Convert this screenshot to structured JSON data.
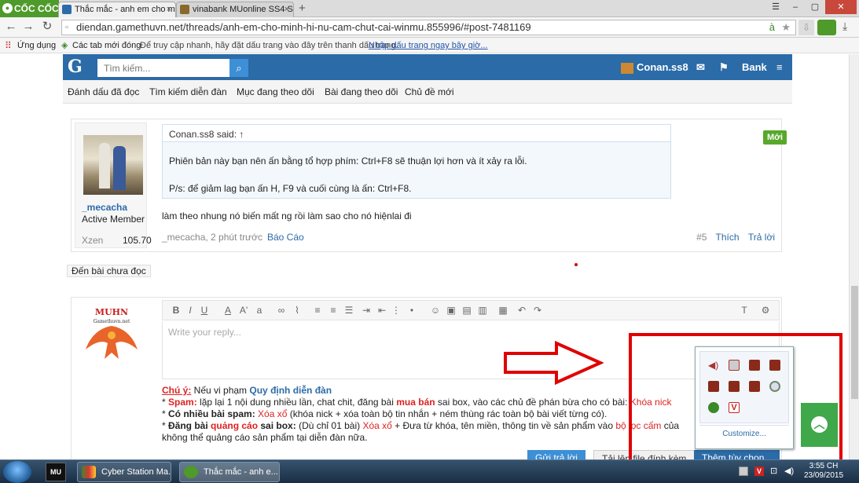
{
  "browser": {
    "logo": "CỐC CỐC",
    "tabs": [
      {
        "title": "Thắc mắc - anh em cho mì",
        "active": true
      },
      {
        "title": "vinabank MUonline SS4 SS",
        "active": false
      }
    ],
    "new_tab": "+",
    "url": "diendan.gamethuvn.net/threads/anh-em-cho-minh-hi-nu-cam-chut-cai-winmu.855996/#post-7481169",
    "bookmarks": {
      "apps": "Ứng dụng",
      "item1": "Các tab mới đóng",
      "hint": "Để truy cập nhanh, hãy đặt dấu trang vào đây trên thanh dấu trang.",
      "link": "Nhập dấu trang ngay bây giờ..."
    }
  },
  "site": {
    "logo": "G",
    "search_placeholder": "Tìm kiếm...",
    "user": "Conan.ss8",
    "bank": "Bank",
    "subnav": [
      "Đánh dấu đã đọc",
      "Tìm kiếm diễn đàn",
      "Mục đang theo dõi",
      "Bài đang theo dõi",
      "Chủ đề mới"
    ]
  },
  "post": {
    "username": "_mecacha",
    "role": "Active Member",
    "xzen_label": "Xzen",
    "xzen_value": "105.70",
    "quote_author": "Conan.ss8 said: ↑",
    "quote_line1": "Phiên bản này bạn nên ấn bằng tổ hợp phím: Ctrl+F8 sẽ thuận lợi hơn và ít xảy ra lỗi.",
    "quote_line2": "P/s: để giảm lag bạn ấn H, F9 và cuối cùng là ấn: Ctrl+F8.",
    "message": "làm theo nhung nó biến mất ng rồi làm sao cho nó hiệnlai đi",
    "meta": "_mecacha, 2 phút trước",
    "report": "Báo Cáo",
    "number": "#5",
    "like": "Thích",
    "reply": "Trả lời",
    "badge": "Mới"
  },
  "unread": "Đến bài chưa đọc",
  "reply": {
    "avatar_text1": "MUHN",
    "avatar_text2": "Gamethuvn.net",
    "placeholder": "Write your reply...",
    "note_title": "Chú ý:",
    "note_title_rest": " Nếu vi phạm ",
    "note_rules": "Quy định diễn đàn",
    "line1_a": "* ",
    "line1_b": "Spam:",
    "line1_c": " lặp lại 1 nội dung nhiều lần, chat chit, đăng bài ",
    "line1_d": "mua bán",
    "line1_e": " sai box, vào các chủ đề phán bừa cho có bài: ",
    "line1_f": "Khóa nick",
    "line2_a": "* ",
    "line2_b": "Có nhiều bài spam:",
    "line2_c": " ",
    "line2_d": "Xóa xổ",
    "line2_e": " (khóa nick + xóa toàn bộ tin nhắn + ném thùng rác toàn bộ bài viết từng có).",
    "line3_a": "* ",
    "line3_b": "Đăng bài ",
    "line3_c": "quảng cáo",
    "line3_d": " sai box:",
    "line3_e": " (Dù chỉ 01 bài) ",
    "line3_f": "Xóa xổ",
    "line3_g": " + Đưa từ khóa, tên miền, thông tin về sản phẩm vào ",
    "line3_h": "bộ lọc cấm",
    "line3_i": " của",
    "line4": "không thể quảng cáo sản phẩm tại diễn đàn nữa.",
    "btn_send": "Gửi trả lời",
    "btn_attach": "Tải lên file đính kèm",
    "btn_more": "Thêm tùy chọn..."
  },
  "tray": {
    "customize": "Customize..."
  },
  "taskbar": {
    "items": [
      "Cyber Station Ma...",
      "Thắc mắc - anh e..."
    ],
    "time": "3:55 CH",
    "date": "23/09/2015"
  }
}
